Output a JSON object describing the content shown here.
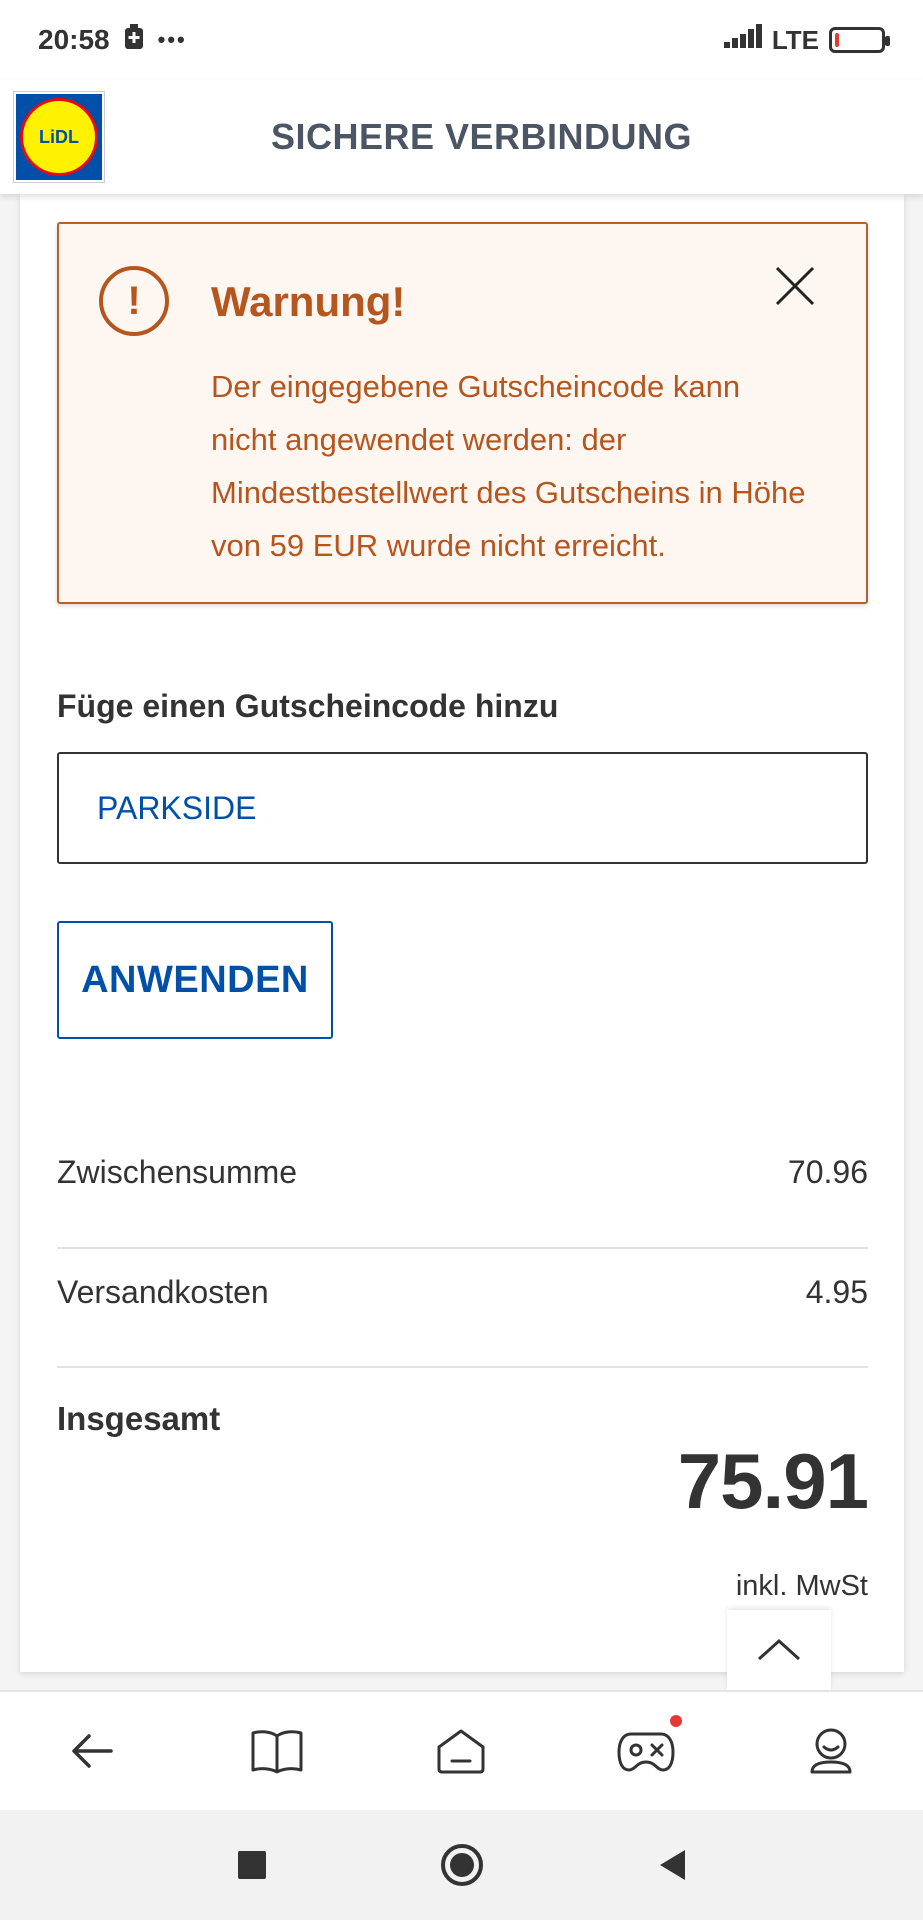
{
  "status_bar": {
    "time": "20:58",
    "dots": "•••",
    "network": "LTE"
  },
  "header": {
    "logo_text": "LiDL",
    "title": "SICHERE VERBINDUNG"
  },
  "warning": {
    "title": "Warnung!",
    "message": "Der eingegebene Gutscheincode kann nicht angewendet werden: der Mindestbestellwert des Gutscheins in Höhe von 59 EUR wurde nicht erreicht."
  },
  "coupon": {
    "label": "Füge einen Gutscheincode hinzu",
    "value": "PARKSIDE",
    "apply_label": "ANWENDEN"
  },
  "summary": {
    "subtotal_label": "Zwischensumme",
    "subtotal_value": "70.96",
    "shipping_label": "Versandkosten",
    "shipping_value": "4.95",
    "total_label": "Insgesamt",
    "total_value": "75.91",
    "vat_note": "inkl. MwSt"
  },
  "bottom_nav": {
    "items": [
      "back-arrow-icon",
      "book-icon",
      "home-icon",
      "gamepad-icon",
      "user-icon"
    ]
  },
  "colors": {
    "brand_blue": "#0050aa",
    "warning_orange": "#b5561f",
    "warning_bg": "#fdf6f1"
  }
}
